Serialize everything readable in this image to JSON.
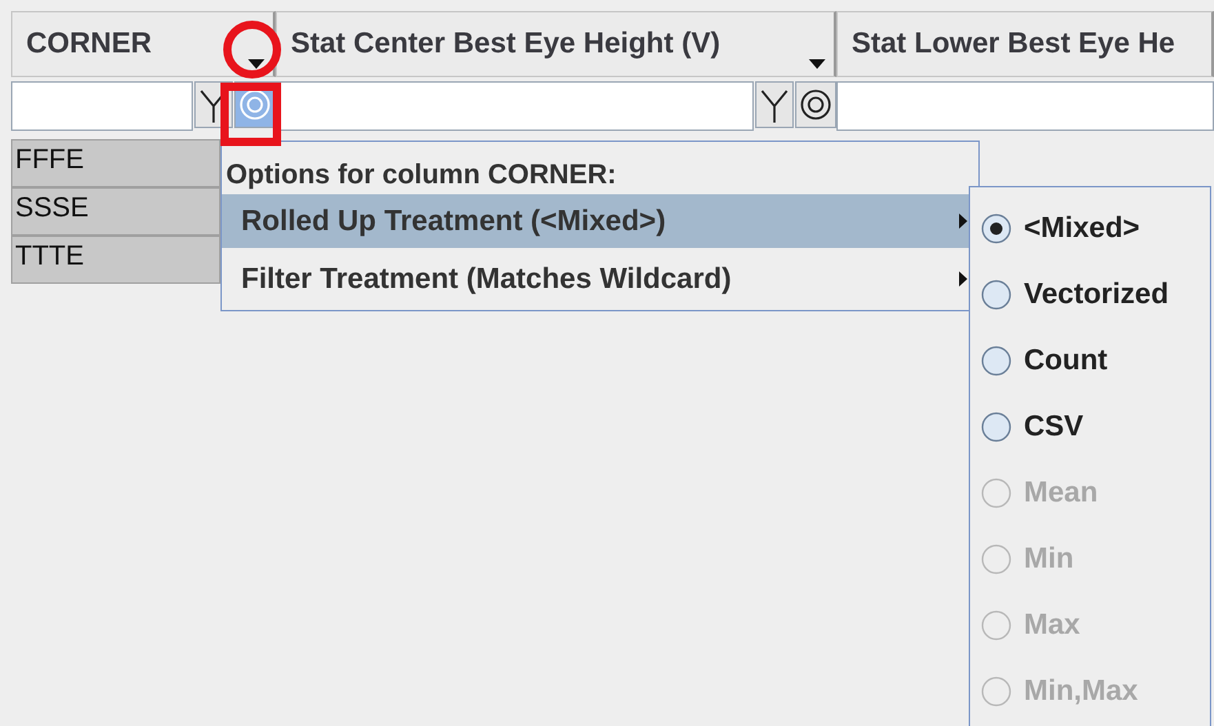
{
  "columns": [
    {
      "title": "CORNER",
      "menu_arrow": true,
      "filter_active": true
    },
    {
      "title": "Stat Center Best Eye Height (V)",
      "menu_arrow": true,
      "filter_active": false
    },
    {
      "title": "Stat Lower Best Eye He",
      "menu_arrow": false
    }
  ],
  "rows": [
    {
      "cell": "FFFE"
    },
    {
      "cell": "SSSE"
    },
    {
      "cell": "TTTE"
    }
  ],
  "popup": {
    "title": "Options for column CORNER:",
    "items": [
      {
        "label": "Rolled Up Treatment (<Mixed>)",
        "selected": true
      },
      {
        "label": "Filter Treatment (Matches Wildcard)",
        "selected": false
      }
    ]
  },
  "submenu": {
    "options": [
      {
        "label": "<Mixed>",
        "selected": true,
        "disabled": false
      },
      {
        "label": "Vectorized",
        "selected": false,
        "disabled": false
      },
      {
        "label": "Count",
        "selected": false,
        "disabled": false
      },
      {
        "label": "CSV",
        "selected": false,
        "disabled": false
      },
      {
        "label": "Mean",
        "selected": false,
        "disabled": true
      },
      {
        "label": "Min",
        "selected": false,
        "disabled": true
      },
      {
        "label": "Max",
        "selected": false,
        "disabled": true
      },
      {
        "label": "Min,Max",
        "selected": false,
        "disabled": true
      }
    ]
  },
  "annotations": [
    {
      "kind": "ring"
    },
    {
      "kind": "frame"
    }
  ]
}
